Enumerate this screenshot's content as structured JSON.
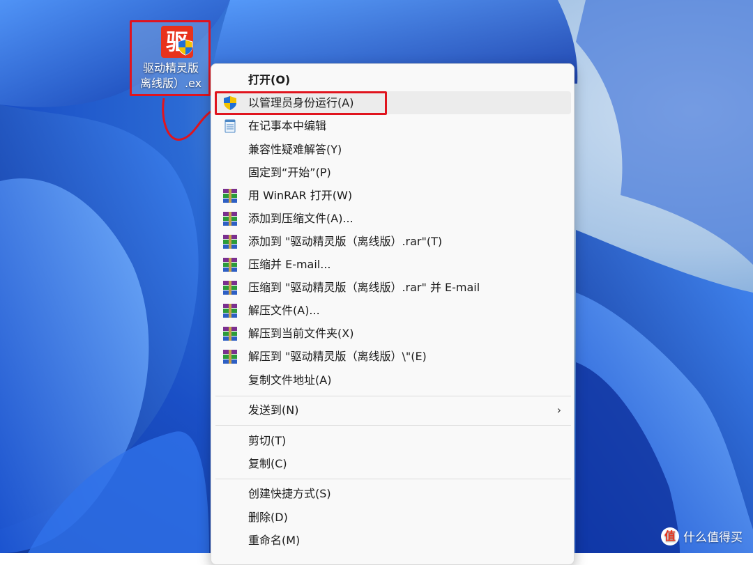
{
  "desktop": {
    "icon": {
      "glyph": "驱",
      "name_line1": "驱动精灵版",
      "name_line2": "离线版）.ex"
    }
  },
  "context_menu": {
    "items": [
      {
        "label": "打开(O)",
        "icon": "none",
        "bold": true
      },
      {
        "label": "以管理员身份运行(A)",
        "icon": "uac-shield-icon",
        "highlighted": true
      },
      {
        "label": "在记事本中编辑",
        "icon": "notepad-icon"
      },
      {
        "label": "兼容性疑难解答(Y)",
        "icon": "none"
      },
      {
        "label": "固定到“开始”(P)",
        "icon": "none"
      },
      {
        "label": "用 WinRAR 打开(W)",
        "icon": "winrar-icon"
      },
      {
        "label": "添加到压缩文件(A)...",
        "icon": "winrar-icon"
      },
      {
        "label": "添加到 \"驱动精灵版（离线版）.rar\"(T)",
        "icon": "winrar-icon"
      },
      {
        "label": "压缩并 E-mail...",
        "icon": "winrar-icon"
      },
      {
        "label": "压缩到 \"驱动精灵版（离线版）.rar\" 并 E-mail",
        "icon": "winrar-icon"
      },
      {
        "label": "解压文件(A)...",
        "icon": "winrar-icon"
      },
      {
        "label": "解压到当前文件夹(X)",
        "icon": "winrar-icon"
      },
      {
        "label": "解压到 \"驱动精灵版（离线版）\\\"(E)",
        "icon": "winrar-icon"
      },
      {
        "label": "复制文件地址(A)",
        "icon": "none"
      },
      {
        "label": "发送到(N)",
        "icon": "none",
        "submenu": true,
        "arrow": "›"
      },
      {
        "label": "剪切(T)",
        "icon": "none"
      },
      {
        "label": "复制(C)",
        "icon": "none"
      },
      {
        "label": "创建快捷方式(S)",
        "icon": "none"
      },
      {
        "label": "删除(D)",
        "icon": "none"
      },
      {
        "label": "重命名(M)",
        "icon": "none"
      }
    ]
  },
  "watermark": {
    "logo_glyph": "值",
    "text": "什么值得买"
  },
  "colors": {
    "highlight": "#e0141e",
    "menu_bg": "#f9f9f9",
    "hover_bg": "#ececec"
  }
}
